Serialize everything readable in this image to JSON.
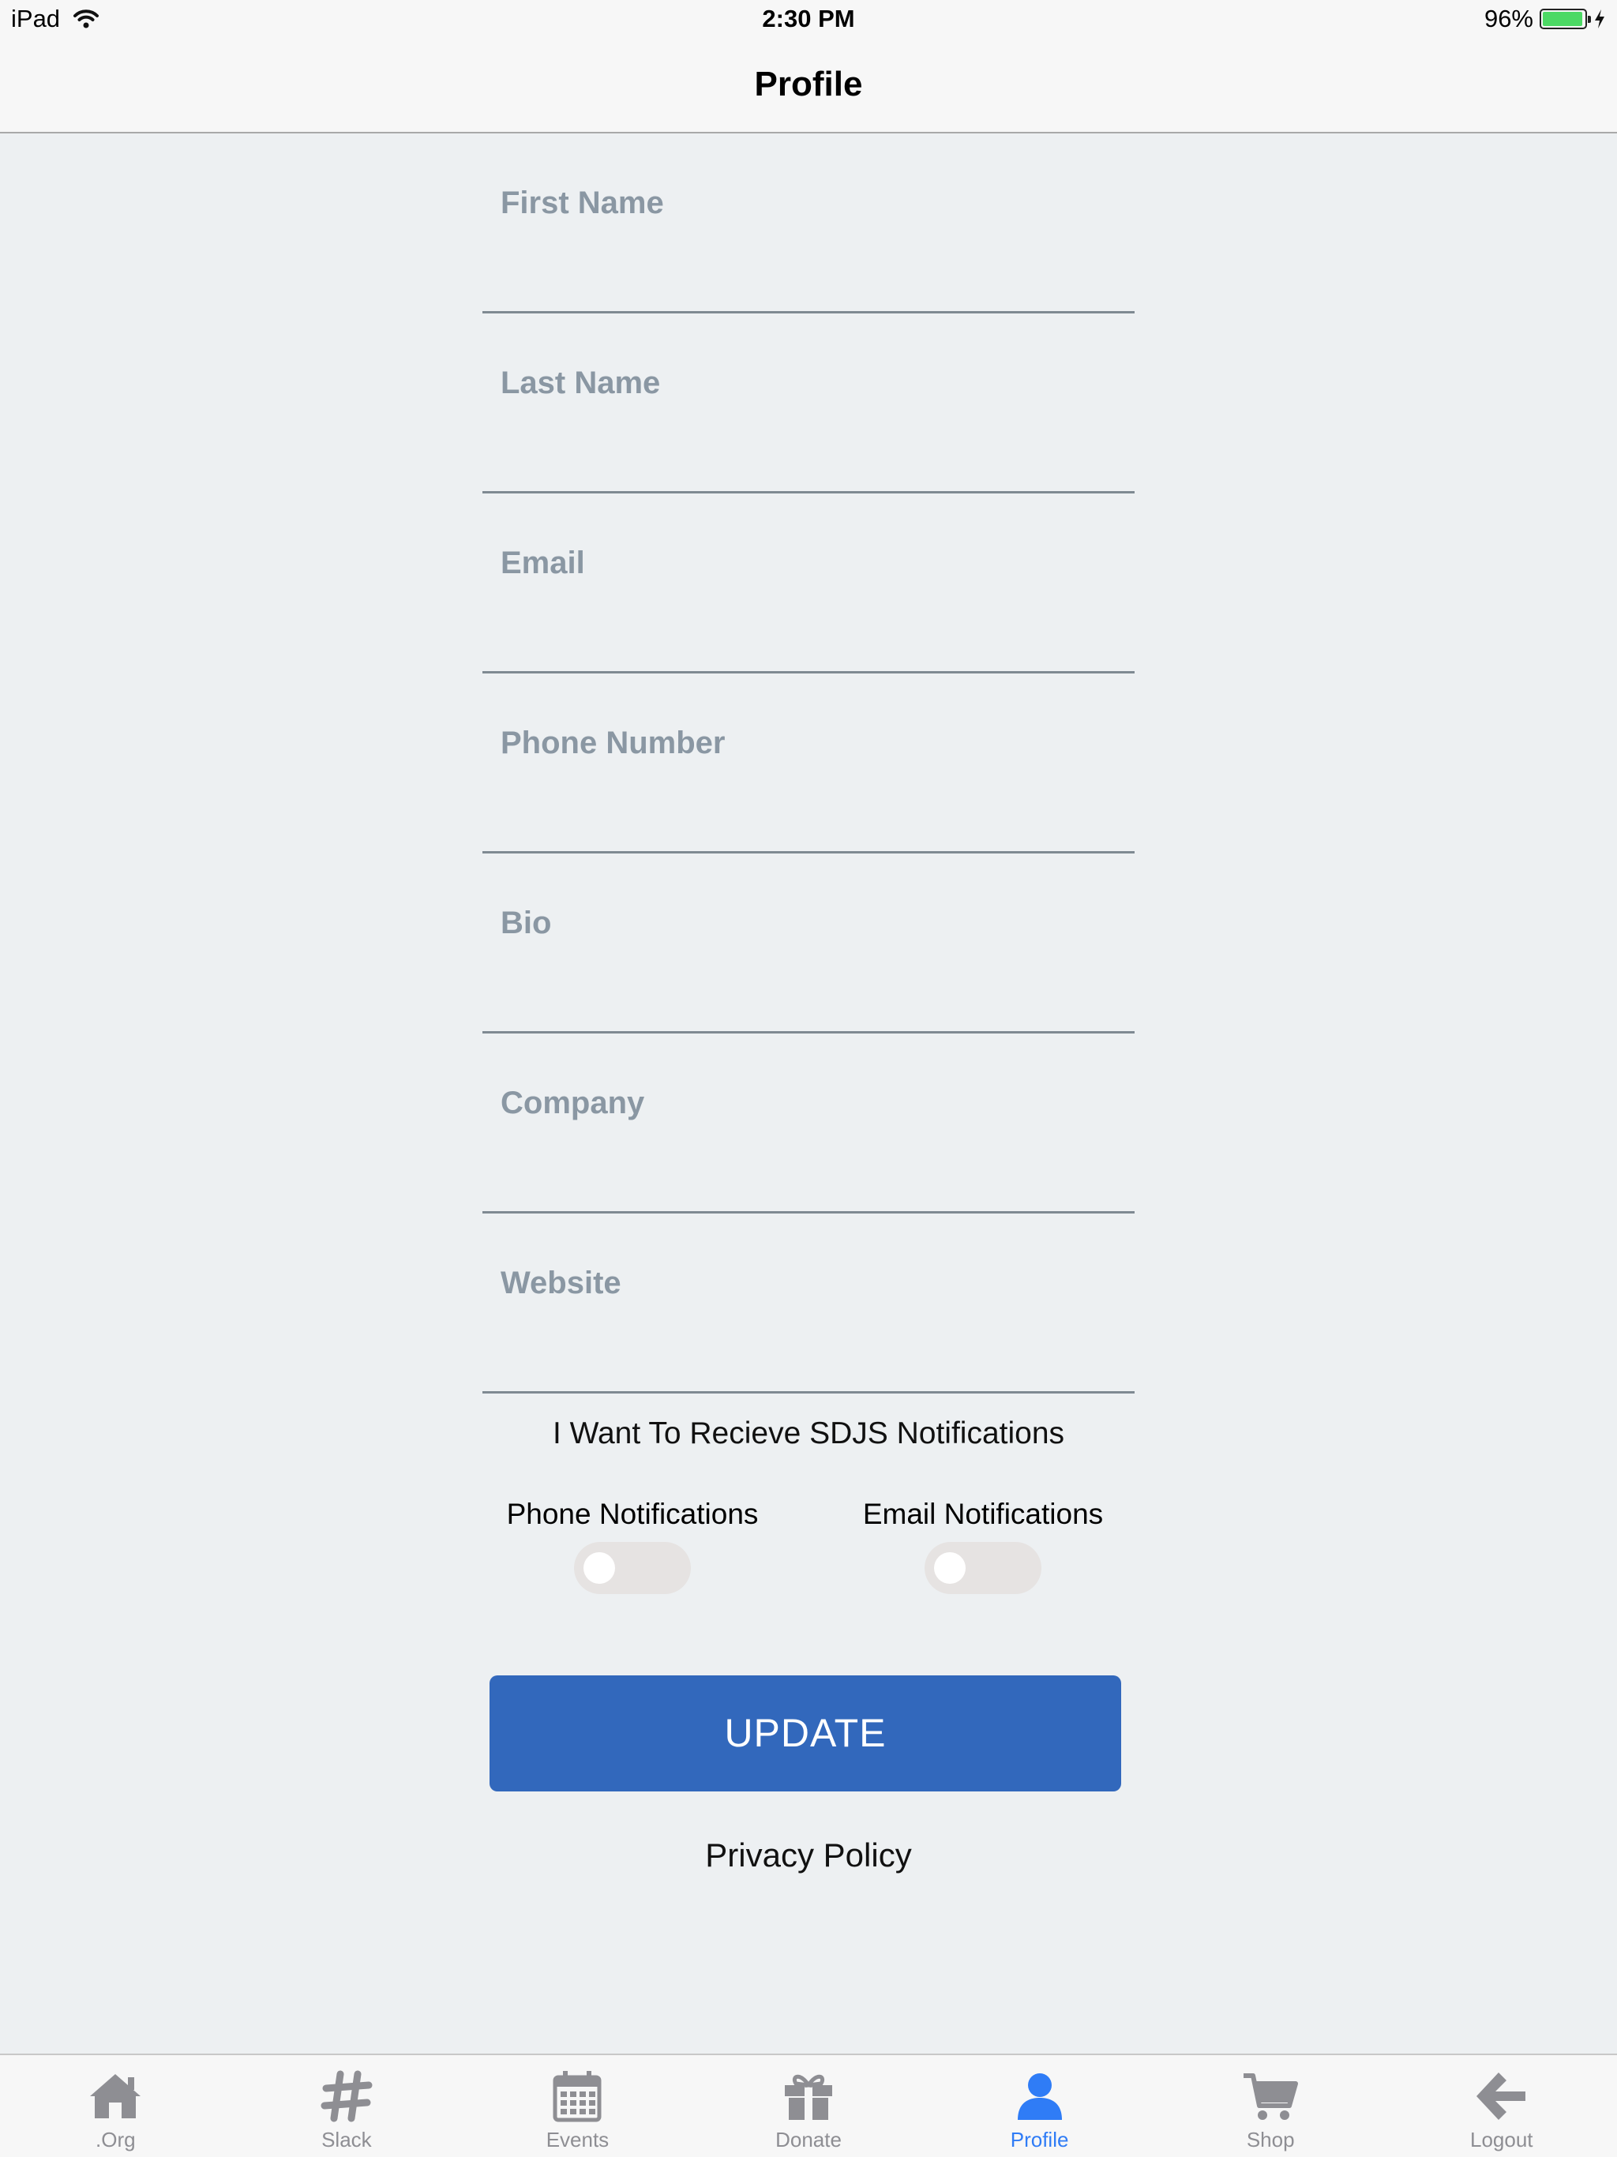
{
  "status_bar": {
    "device": "iPad",
    "time": "2:30 PM",
    "battery_text": "96%",
    "battery_level": 0.96,
    "battery_color": "#4cd964"
  },
  "nav": {
    "title": "Profile"
  },
  "form": {
    "first_name": {
      "placeholder": "First Name"
    },
    "last_name": {
      "placeholder": "Last Name"
    },
    "email": {
      "placeholder": "Email"
    },
    "phone": {
      "placeholder": "Phone Number"
    },
    "bio": {
      "placeholder": "Bio"
    },
    "company": {
      "placeholder": "Company"
    },
    "website": {
      "placeholder": "Website"
    }
  },
  "notifications": {
    "title": "I Want To Recieve SDJS Notifications",
    "phone_label": "Phone Notifications",
    "phone_on": false,
    "email_label": "Email Notifications",
    "email_on": false
  },
  "update_label": "UPDATE",
  "update_color": "#3268bc",
  "privacy_label": "Privacy Policy",
  "tabs": {
    "org": {
      "label": ".Org",
      "icon": "home-icon"
    },
    "slack": {
      "label": "Slack",
      "icon": "hashtag-icon"
    },
    "events": {
      "label": "Events",
      "icon": "calendar-icon"
    },
    "donate": {
      "label": "Donate",
      "icon": "gift-icon"
    },
    "profile": {
      "label": "Profile",
      "icon": "user-icon",
      "active": true
    },
    "shop": {
      "label": "Shop",
      "icon": "cart-icon"
    },
    "logout": {
      "label": "Logout",
      "icon": "arrow-left-icon"
    }
  },
  "active_tab_color": "#2f7cf6",
  "inactive_tab_color": "#8e8e93"
}
